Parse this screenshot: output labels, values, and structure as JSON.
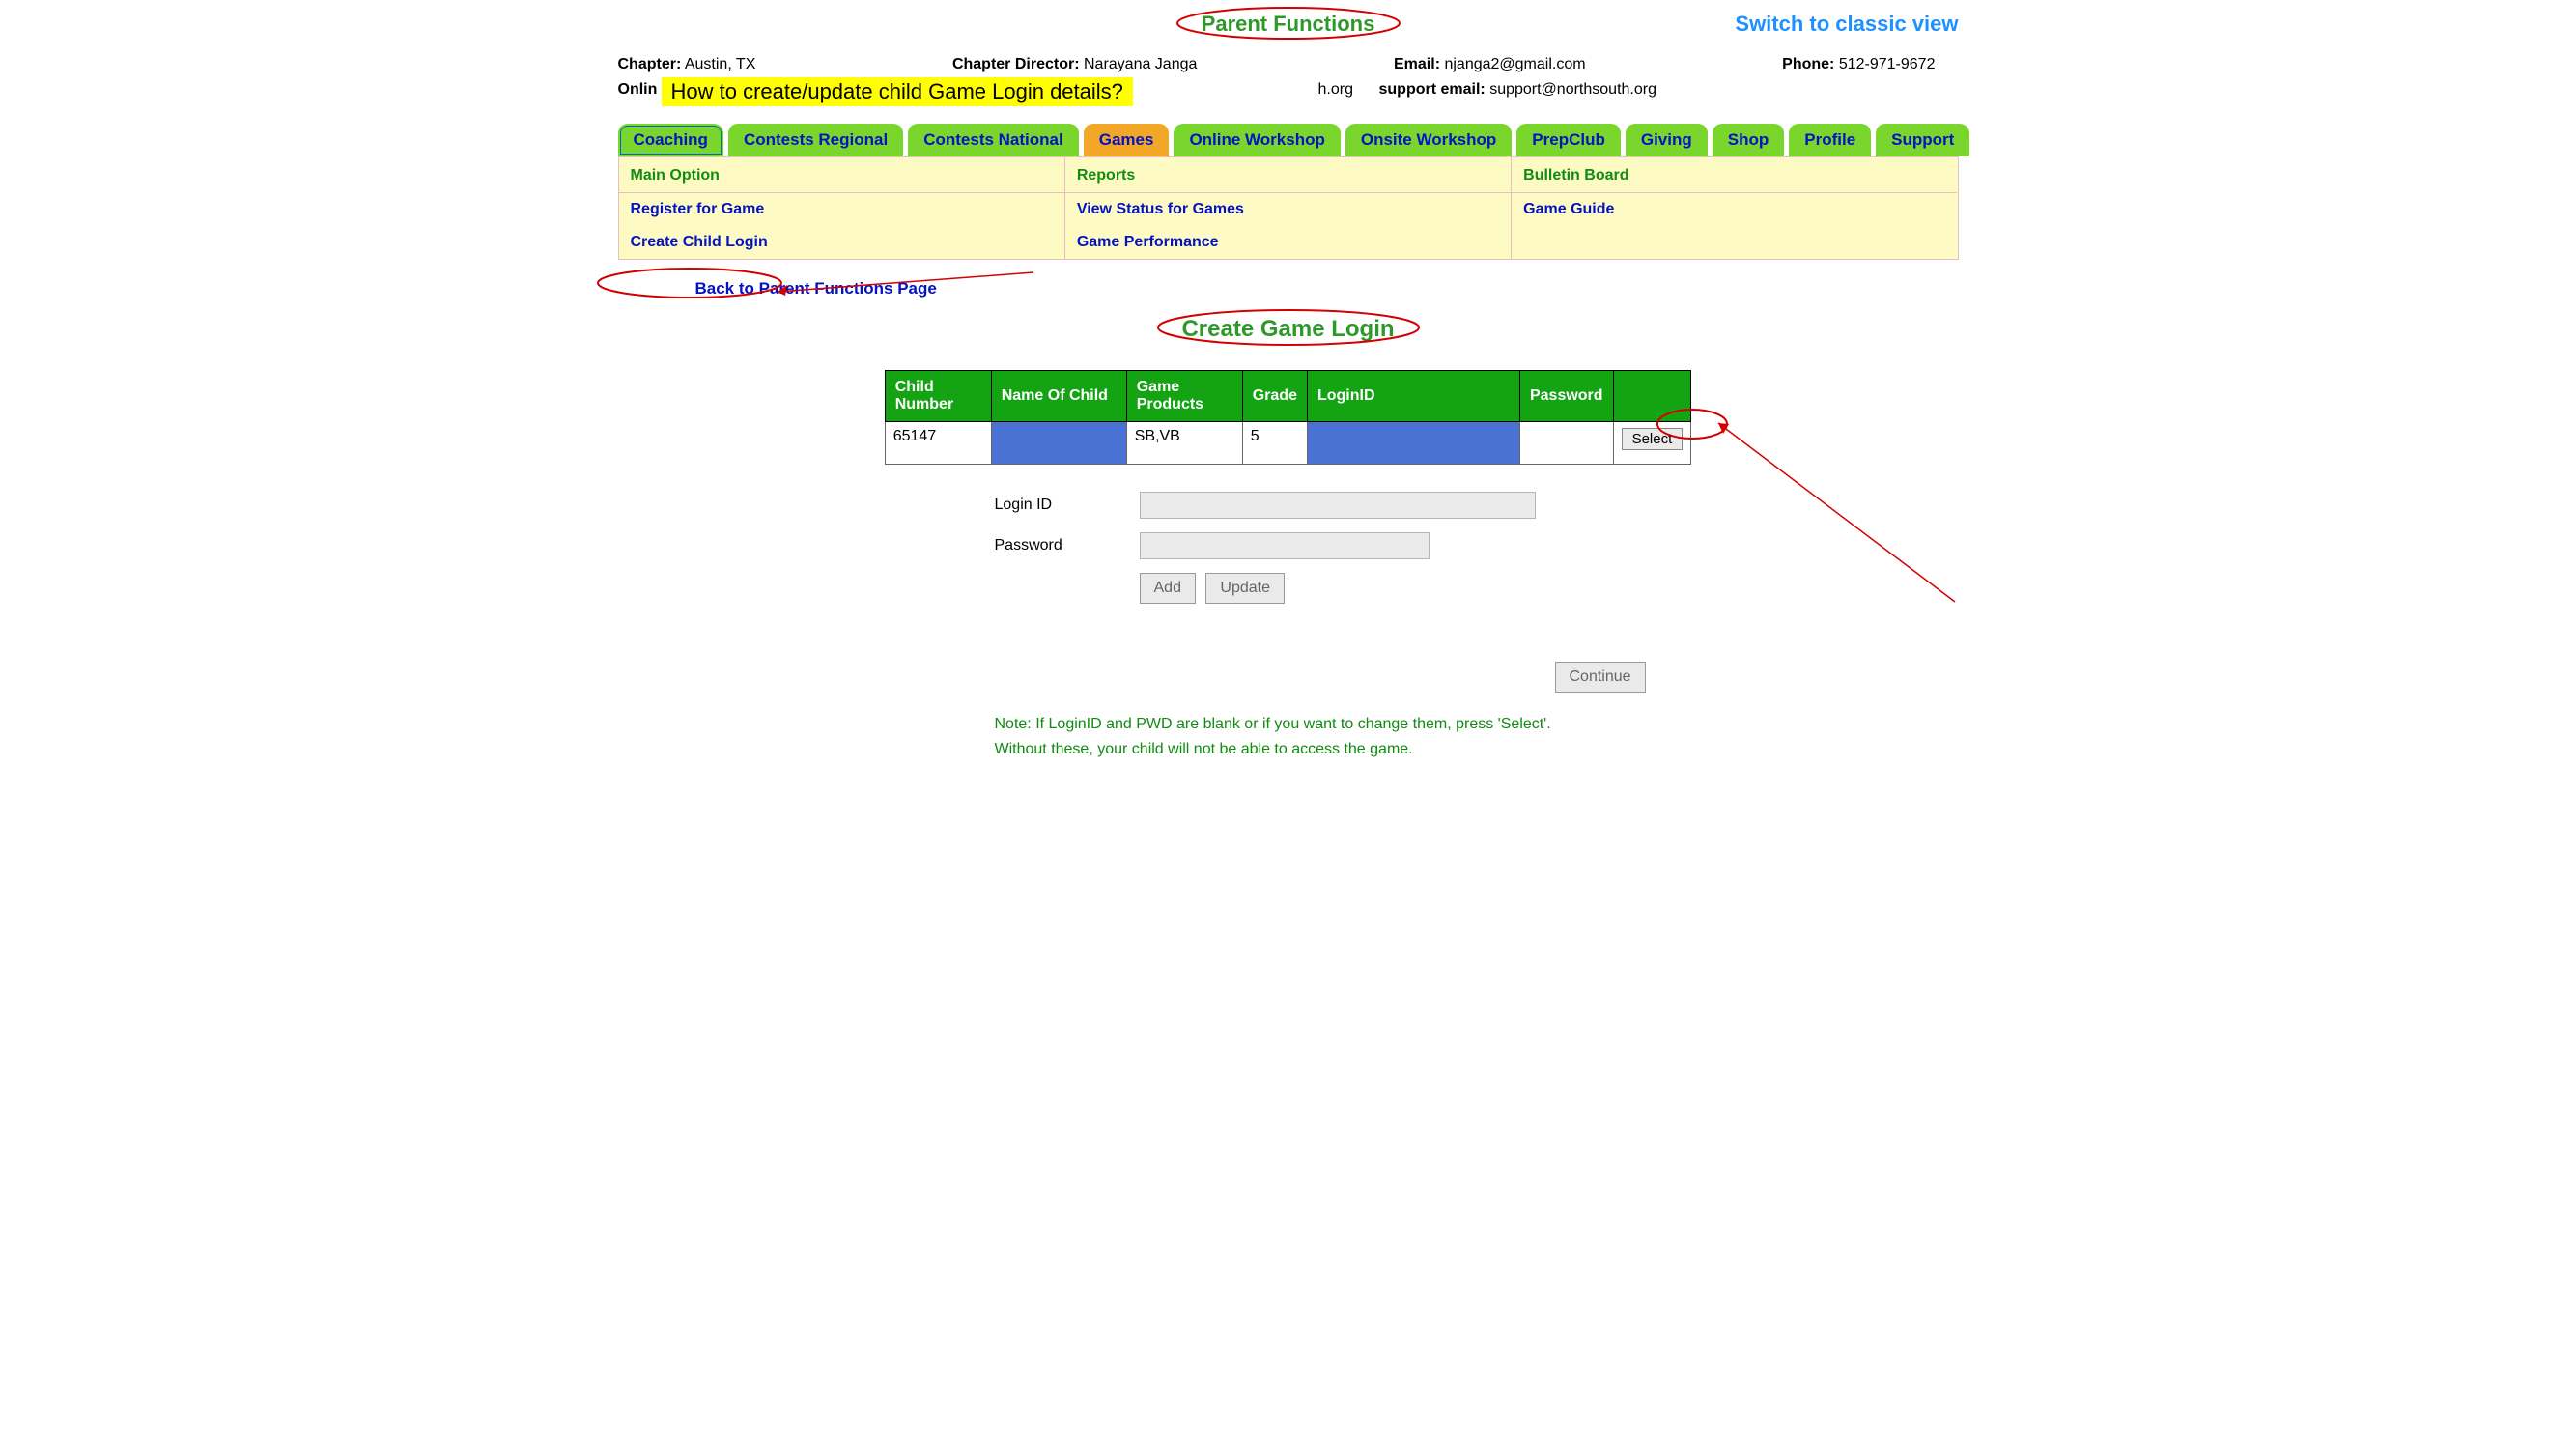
{
  "header": {
    "title": "Parent Functions",
    "switch_link": "Switch to classic view"
  },
  "info": {
    "chapter_label": "Chapter:",
    "chapter_value": "Austin, TX",
    "director_label": "Chapter Director:",
    "director_value": "Narayana Janga",
    "email_label": "Email:",
    "email_value": "njanga2@gmail.com",
    "phone_label": "Phone:",
    "phone_value": "512-971-9672",
    "onlin_prefix": "Onlin",
    "highlight_text": "How to create/update child Game Login details?",
    "horg_fragment": "h.org",
    "support_email_label": "support email:",
    "support_email_value": "support@northsouth.org"
  },
  "tabs": [
    {
      "label": "Coaching",
      "selected": false,
      "boxed": true
    },
    {
      "label": "Contests Regional",
      "selected": false,
      "boxed": false
    },
    {
      "label": "Contests National",
      "selected": false,
      "boxed": false
    },
    {
      "label": "Games",
      "selected": true,
      "boxed": false
    },
    {
      "label": "Online Workshop",
      "selected": false,
      "boxed": false
    },
    {
      "label": "Onsite Workshop",
      "selected": false,
      "boxed": false
    },
    {
      "label": "PrepClub",
      "selected": false,
      "boxed": false
    },
    {
      "label": "Giving",
      "selected": false,
      "boxed": false
    },
    {
      "label": "Shop",
      "selected": false,
      "boxed": false
    },
    {
      "label": "Profile",
      "selected": false,
      "boxed": false
    },
    {
      "label": "Support",
      "selected": false,
      "boxed": false
    }
  ],
  "submenu": {
    "cols": [
      {
        "header": "Main Option",
        "items": [
          "Register for Game",
          "Create Child Login"
        ]
      },
      {
        "header": "Reports",
        "items": [
          "View Status for Games",
          "Game Performance"
        ]
      },
      {
        "header": "Bulletin Board",
        "items": [
          "Game Guide"
        ]
      }
    ]
  },
  "back_link": "Back to Parent Functions Page",
  "section_title": "Create Game Login",
  "table": {
    "headers": [
      "Child Number",
      "Name Of Child",
      "Game Products",
      "Grade",
      "LoginID",
      "Password",
      ""
    ],
    "rows": [
      {
        "child_number": "65147",
        "name": "",
        "products": "SB,VB",
        "grade": "5",
        "login": "",
        "password": "",
        "action": "Select"
      }
    ]
  },
  "form": {
    "login_label": "Login ID",
    "login_value": "",
    "password_label": "Password",
    "password_value": "",
    "add_btn": "Add",
    "update_btn": "Update",
    "continue_btn": "Continue"
  },
  "note": {
    "line1": "Note: If LoginID and PWD are blank or if you want to change them, press 'Select'.",
    "line2": "Without these, your child will not be able to access the game."
  }
}
